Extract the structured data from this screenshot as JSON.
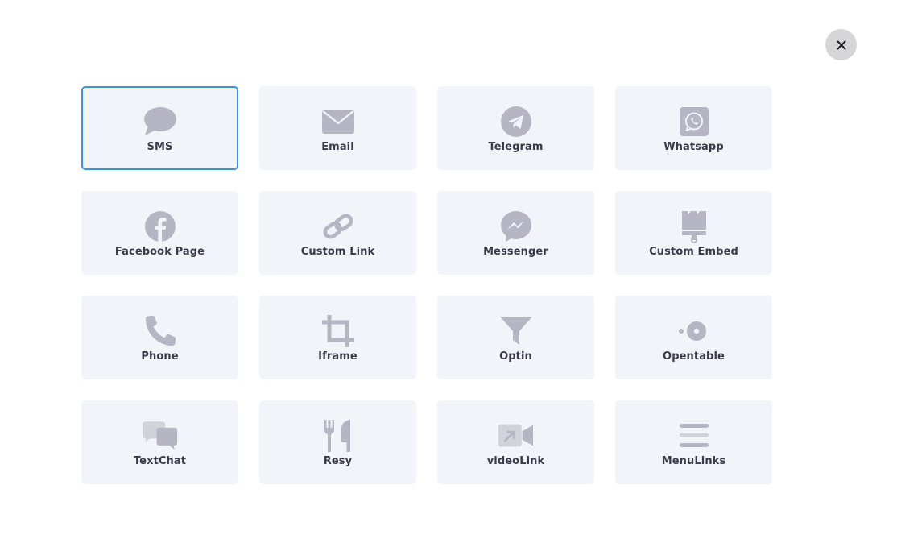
{
  "dialog": {
    "close_icon": "close-icon",
    "selected_index": 0
  },
  "colors": {
    "tile_background": "#f1f4f8",
    "icon_gray": "#b6b5c3",
    "label_text": "#3a3b4a",
    "selected_border": "#3b91e5",
    "close_background": "#d6d6d9"
  },
  "tiles": [
    {
      "label": "SMS",
      "icon": "sms-icon"
    },
    {
      "label": "Email",
      "icon": "email-icon"
    },
    {
      "label": "Telegram",
      "icon": "telegram-icon"
    },
    {
      "label": "Whatsapp",
      "icon": "whatsapp-icon"
    },
    {
      "label": "Facebook Page",
      "icon": "facebook-icon"
    },
    {
      "label": "Custom Link",
      "icon": "link-icon"
    },
    {
      "label": "Messenger",
      "icon": "messenger-icon"
    },
    {
      "label": "Custom Embed",
      "icon": "paintbrush-icon"
    },
    {
      "label": "Phone",
      "icon": "phone-icon"
    },
    {
      "label": "Iframe",
      "icon": "crop-icon"
    },
    {
      "label": "Optin",
      "icon": "funnel-icon"
    },
    {
      "label": "Opentable",
      "icon": "opentable-icon"
    },
    {
      "label": "TextChat",
      "icon": "chat-bubbles-icon"
    },
    {
      "label": "Resy",
      "icon": "utensils-icon"
    },
    {
      "label": "videoLink",
      "icon": "video-icon"
    },
    {
      "label": "MenuLinks",
      "icon": "menu-lines-icon"
    }
  ]
}
